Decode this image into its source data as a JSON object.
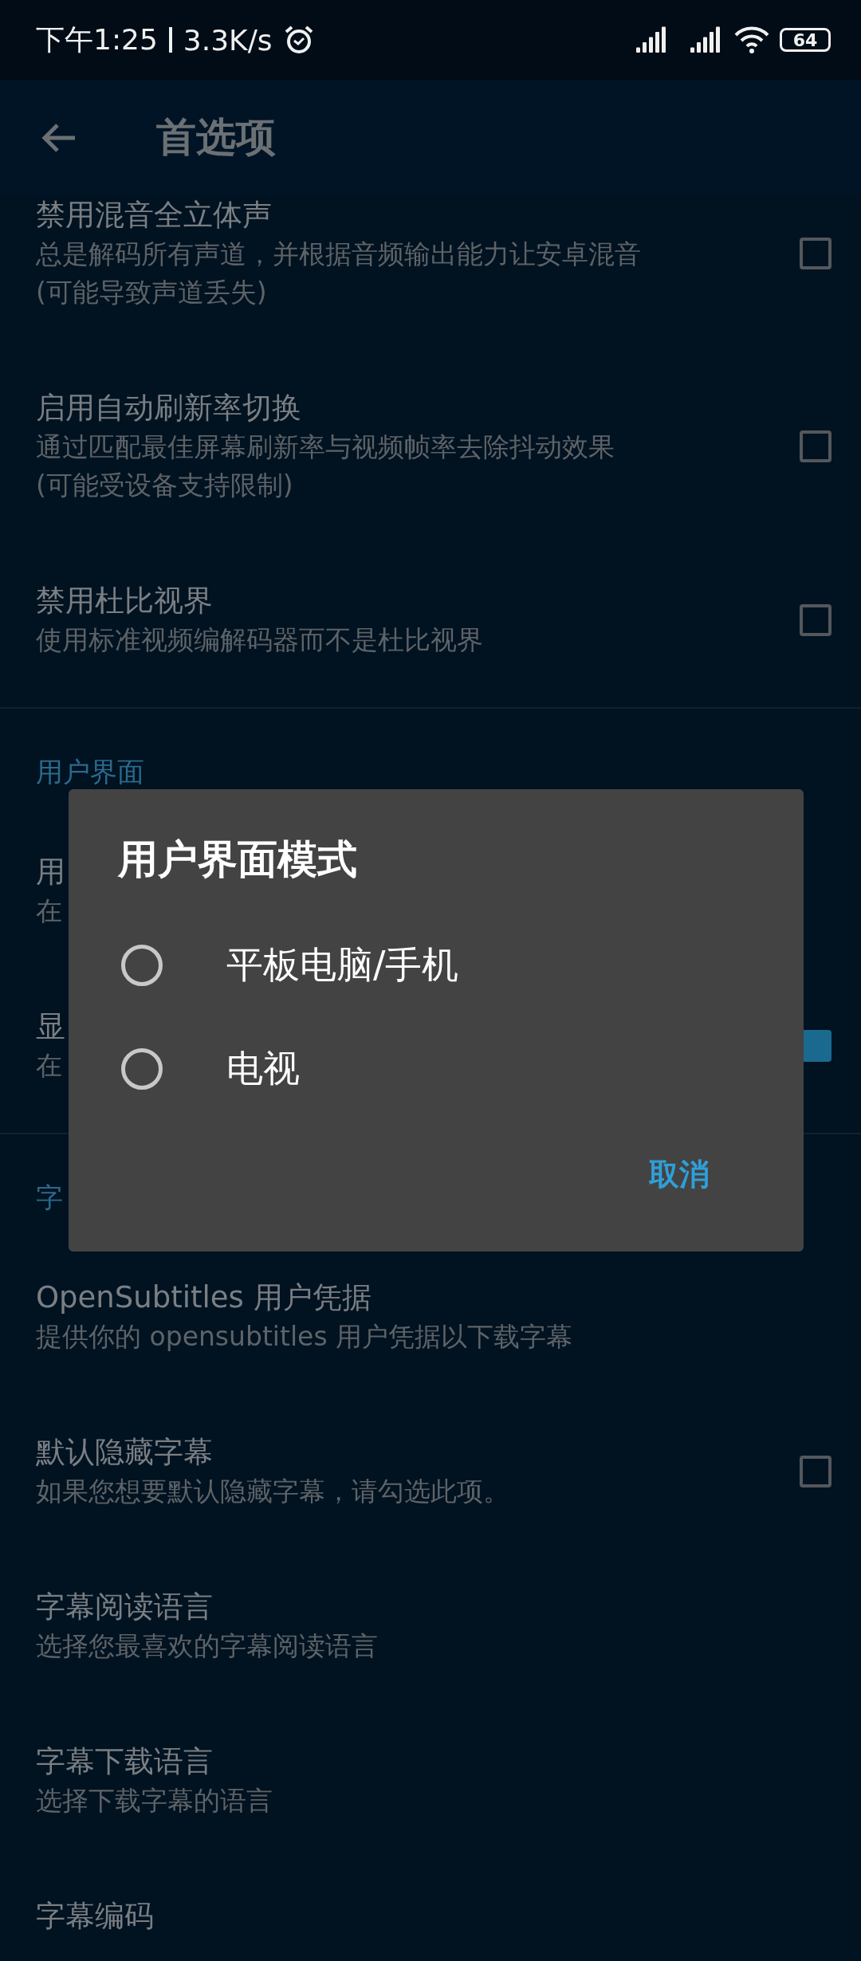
{
  "status_bar": {
    "time": "下午1:25",
    "speed": "3.3K/s",
    "battery": "64"
  },
  "app_bar": {
    "title": "首选项"
  },
  "settings": [
    {
      "kind": "checkbox",
      "title": "禁用混音全立体声",
      "description": "总是解码所有声道，并根据音频输出能力让安卓混音(可能导致声道丢失)",
      "checked": false
    },
    {
      "kind": "checkbox",
      "title": "启用自动刷新率切换",
      "description": "通过匹配最佳屏幕刷新率与视频帧率去除抖动效果(可能受设备支持限制)",
      "checked": false
    },
    {
      "kind": "checkbox",
      "title": "禁用杜比视界",
      "description": "使用标准视频编解码器而不是杜比视界",
      "checked": false
    },
    {
      "kind": "divider"
    },
    {
      "kind": "section",
      "title": "用户界面"
    },
    {
      "kind": "text",
      "title": "用",
      "description": "在"
    },
    {
      "kind": "checkbox",
      "title": "显",
      "description": "在",
      "checked": true
    },
    {
      "kind": "divider"
    },
    {
      "kind": "section",
      "title": "字"
    },
    {
      "kind": "text",
      "title": "OpenSubtitles 用户凭据",
      "description": "提供你的 opensubtitles 用户凭据以下载字幕"
    },
    {
      "kind": "checkbox",
      "title": "默认隐藏字幕",
      "description": "如果您想要默认隐藏字幕，请勾选此项。",
      "checked": false
    },
    {
      "kind": "text",
      "title": "字幕阅读语言",
      "description": "选择您最喜欢的字幕阅读语言"
    },
    {
      "kind": "text",
      "title": "字幕下载语言",
      "description": "选择下载字幕的语言"
    },
    {
      "kind": "text",
      "title": "字幕编码"
    }
  ],
  "dialog": {
    "title": "用户界面模式",
    "options": [
      {
        "label": "平板电脑/手机",
        "selected": false
      },
      {
        "label": "电视",
        "selected": false
      }
    ],
    "cancel": "取消"
  }
}
